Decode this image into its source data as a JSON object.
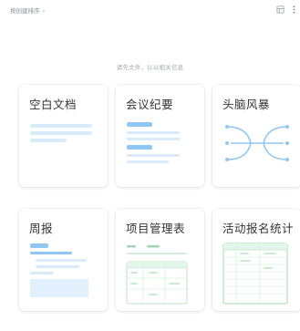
{
  "toolbar": {
    "sort_label": "按创建排序",
    "sort_icon": "chevron-down-icon",
    "icons": [
      "layout-icon",
      "more-vertical-icon"
    ]
  },
  "hint": "请先文件，以以相关信息",
  "cards": [
    {
      "title": "空白文档",
      "preview": "blank-doc-preview"
    },
    {
      "title": "会议纪要",
      "preview": "meeting-notes-preview"
    },
    {
      "title": "头脑风暴",
      "preview": "mindmap-preview"
    },
    {
      "title": "周报",
      "preview": "weekly-report-preview"
    },
    {
      "title": "项目管理表",
      "preview": "project-table-preview"
    },
    {
      "title": "活动报名统计",
      "preview": "signup-table-preview"
    }
  ],
  "colors": {
    "blue_strong": "#8fc7f2",
    "blue_light": "#d7ebfb",
    "green_strong": "#9fd8ae",
    "green_light": "#e4f5e9",
    "text": "#333333",
    "muted": "#a3a8b0"
  }
}
